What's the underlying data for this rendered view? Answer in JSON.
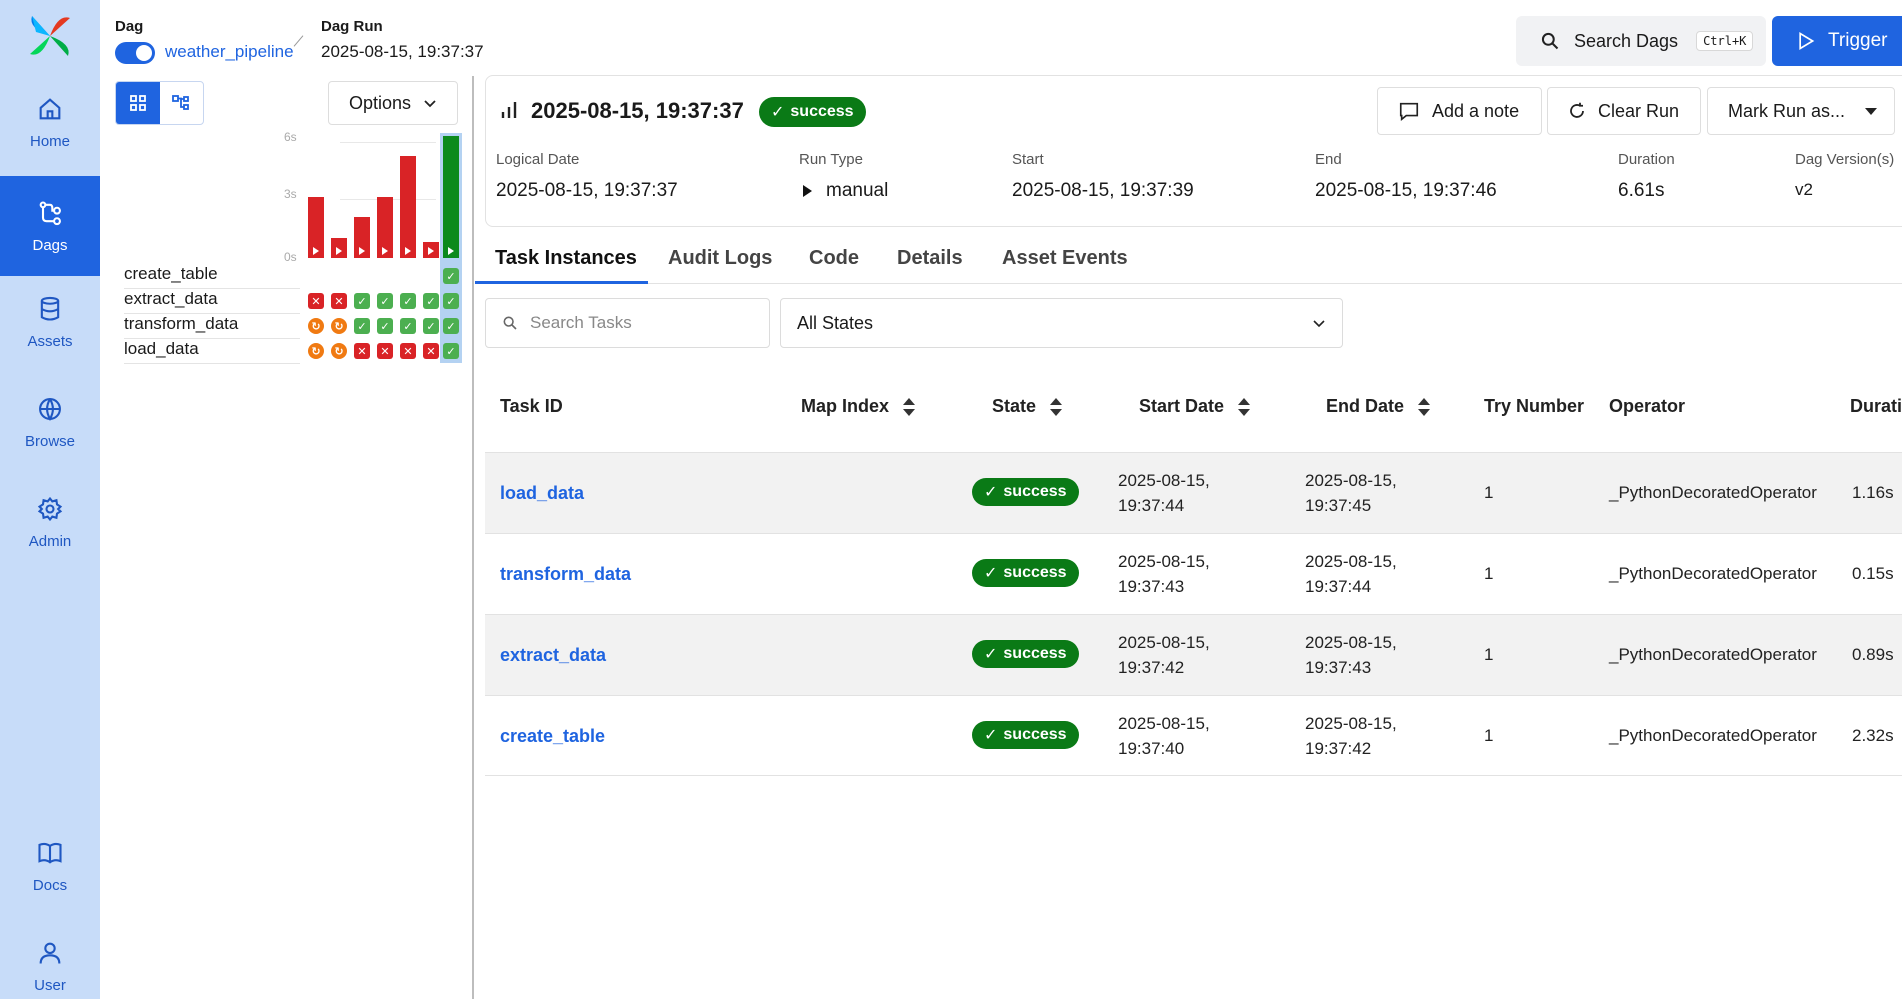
{
  "sidebar": {
    "items": [
      {
        "label": "Home",
        "icon": "home-icon"
      },
      {
        "label": "Dags",
        "icon": "dags-icon",
        "active": true
      },
      {
        "label": "Assets",
        "icon": "database-icon"
      },
      {
        "label": "Browse",
        "icon": "globe-icon"
      },
      {
        "label": "Admin",
        "icon": "gear-icon"
      },
      {
        "label": "Docs",
        "icon": "book-icon"
      },
      {
        "label": "User",
        "icon": "user-icon"
      }
    ]
  },
  "header": {
    "dag_label": "Dag",
    "dag_name": "weather_pipeline",
    "run_label": "Dag Run",
    "run_value": "2025-08-15, 19:37:37",
    "search_label": "Search Dags",
    "search_shortcut": "Ctrl+K",
    "trigger_label": "Trigger"
  },
  "grid": {
    "options_label": "Options",
    "axis_labels": [
      "6s",
      "3s",
      "0s"
    ],
    "tasks": [
      "create_table",
      "extract_data",
      "transform_data",
      "load_data"
    ],
    "durations_s": [
      3.0,
      1.0,
      2.0,
      3.0,
      5.0,
      0.8,
      6.0
    ],
    "run_states": [
      "failed",
      "failed",
      "failed",
      "failed",
      "failed",
      "failed",
      "success"
    ],
    "cells": {
      "create_table": [
        "",
        "",
        "",
        "",
        "",
        "",
        "success"
      ],
      "extract_data": [
        "failed",
        "failed",
        "success",
        "success",
        "success",
        "success",
        "success"
      ],
      "transform_data": [
        "upstream_failed",
        "upstream_failed",
        "success",
        "success",
        "success",
        "success",
        "success"
      ],
      "load_data": [
        "upstream_failed",
        "upstream_failed",
        "failed",
        "failed",
        "failed",
        "failed",
        "success"
      ]
    },
    "colors": {
      "failed": "#d92326",
      "success": "#4caf50",
      "upstream_failed": "#f07a12",
      "selected": "#b4d2f2"
    }
  },
  "run": {
    "title": "2025-08-15, 19:37:37",
    "state": "success",
    "add_note_label": "Add a note",
    "clear_run_label": "Clear Run",
    "mark_run_label": "Mark Run as...",
    "meta": [
      {
        "label": "Logical Date",
        "value": "2025-08-15, 19:37:37"
      },
      {
        "label": "Run Type",
        "value": "manual"
      },
      {
        "label": "Start",
        "value": "2025-08-15, 19:37:39"
      },
      {
        "label": "End",
        "value": "2025-08-15, 19:37:46"
      },
      {
        "label": "Duration",
        "value": "6.61s"
      },
      {
        "label": "Dag Version(s)",
        "value": "v2"
      }
    ]
  },
  "tabs": [
    "Task Instances",
    "Audit Logs",
    "Code",
    "Details",
    "Asset Events"
  ],
  "filters": {
    "search_placeholder": "Search Tasks",
    "state_value": "All States"
  },
  "table": {
    "columns": [
      "Task ID",
      "Map Index",
      "State",
      "Start Date",
      "End Date",
      "Try Number",
      "Operator",
      "Durati"
    ],
    "rows": [
      {
        "task_id": "load_data",
        "state": "success",
        "start_date": "2025-08-15,",
        "start_time": "19:37:44",
        "end_date": "2025-08-15,",
        "end_time": "19:37:45",
        "try": "1",
        "operator": "_PythonDecoratedOperator",
        "duration": "1.16s"
      },
      {
        "task_id": "transform_data",
        "state": "success",
        "start_date": "2025-08-15,",
        "start_time": "19:37:43",
        "end_date": "2025-08-15,",
        "end_time": "19:37:44",
        "try": "1",
        "operator": "_PythonDecoratedOperator",
        "duration": "0.15s"
      },
      {
        "task_id": "extract_data",
        "state": "success",
        "start_date": "2025-08-15,",
        "start_time": "19:37:42",
        "end_date": "2025-08-15,",
        "end_time": "19:37:43",
        "try": "1",
        "operator": "_PythonDecoratedOperator",
        "duration": "0.89s"
      },
      {
        "task_id": "create_table",
        "state": "success",
        "start_date": "2025-08-15,",
        "start_time": "19:37:40",
        "end_date": "2025-08-15,",
        "end_time": "19:37:42",
        "try": "1",
        "operator": "_PythonDecoratedOperator",
        "duration": "2.32s"
      }
    ]
  },
  "colors": {
    "accent": "#1f64e0",
    "success": "#0a7a16",
    "sidebar_bg": "#c7dcf9"
  }
}
